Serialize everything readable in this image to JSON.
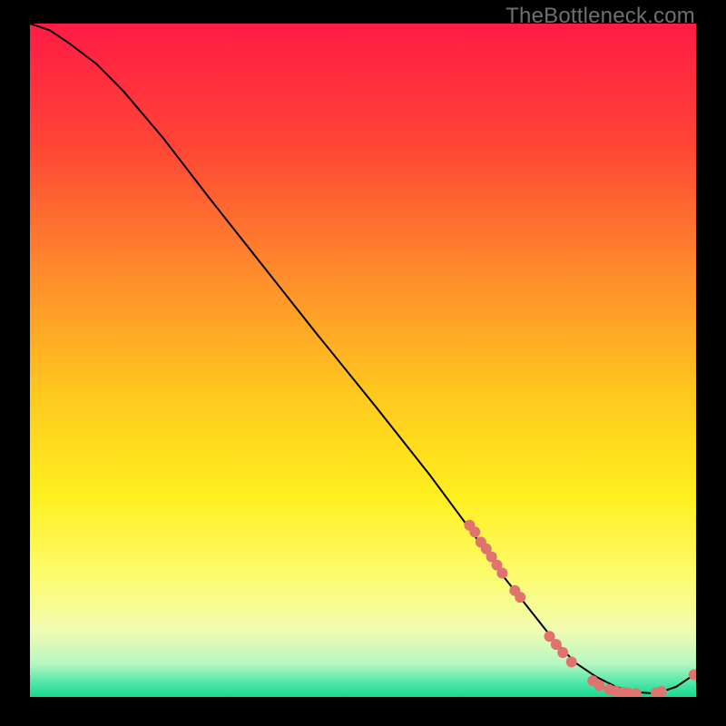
{
  "watermark": "TheBottleneck.com",
  "chart_data": {
    "type": "line",
    "title": "",
    "xlabel": "",
    "ylabel": "",
    "xlim": [
      0,
      100
    ],
    "ylim": [
      0,
      100
    ],
    "grid": false,
    "legend": false,
    "gradient_stops": [
      {
        "pct": 0,
        "color": "#ff1b46"
      },
      {
        "pct": 18,
        "color": "#ff4535"
      },
      {
        "pct": 38,
        "color": "#ff8f2c"
      },
      {
        "pct": 55,
        "color": "#ffc81e"
      },
      {
        "pct": 70,
        "color": "#ffef1f"
      },
      {
        "pct": 82,
        "color": "#fdfc6e"
      },
      {
        "pct": 90,
        "color": "#f0fcb0"
      },
      {
        "pct": 95,
        "color": "#b8f7c2"
      },
      {
        "pct": 98,
        "color": "#4fe6a8"
      },
      {
        "pct": 100,
        "color": "#17d98e"
      }
    ],
    "series": [
      {
        "name": "bottleneck-curve",
        "x": [
          0,
          3,
          6,
          10,
          14,
          20,
          27,
          35,
          43,
          52,
          60,
          66,
          71,
          75,
          79,
          82,
          85,
          88,
          91,
          94,
          97,
          100
        ],
        "values": [
          100,
          99,
          97,
          94,
          90,
          83,
          74,
          64,
          54,
          43,
          33,
          25,
          18,
          13,
          8,
          5,
          3,
          1.5,
          0.7,
          0.5,
          1.5,
          3.5
        ]
      }
    ],
    "markers": {
      "name": "highlight-dots",
      "color": "#e0736d",
      "radius_px": 6,
      "points": [
        {
          "x": 66.0,
          "y": 25.5
        },
        {
          "x": 66.8,
          "y": 24.5
        },
        {
          "x": 67.7,
          "y": 23.0
        },
        {
          "x": 68.5,
          "y": 22.0
        },
        {
          "x": 69.3,
          "y": 20.8
        },
        {
          "x": 70.1,
          "y": 19.6
        },
        {
          "x": 70.9,
          "y": 18.4
        },
        {
          "x": 72.8,
          "y": 15.8
        },
        {
          "x": 73.6,
          "y": 14.8
        },
        {
          "x": 78.0,
          "y": 9.0
        },
        {
          "x": 79.0,
          "y": 7.8
        },
        {
          "x": 80.0,
          "y": 6.6
        },
        {
          "x": 81.3,
          "y": 5.2
        },
        {
          "x": 84.5,
          "y": 2.4
        },
        {
          "x": 85.5,
          "y": 1.7
        },
        {
          "x": 87.0,
          "y": 1.1
        },
        {
          "x": 87.9,
          "y": 0.9
        },
        {
          "x": 89.0,
          "y": 0.7
        },
        {
          "x": 89.8,
          "y": 0.6
        },
        {
          "x": 91.0,
          "y": 0.5
        },
        {
          "x": 94.0,
          "y": 0.6
        },
        {
          "x": 94.8,
          "y": 0.8
        },
        {
          "x": 99.7,
          "y": 3.3
        }
      ]
    }
  }
}
